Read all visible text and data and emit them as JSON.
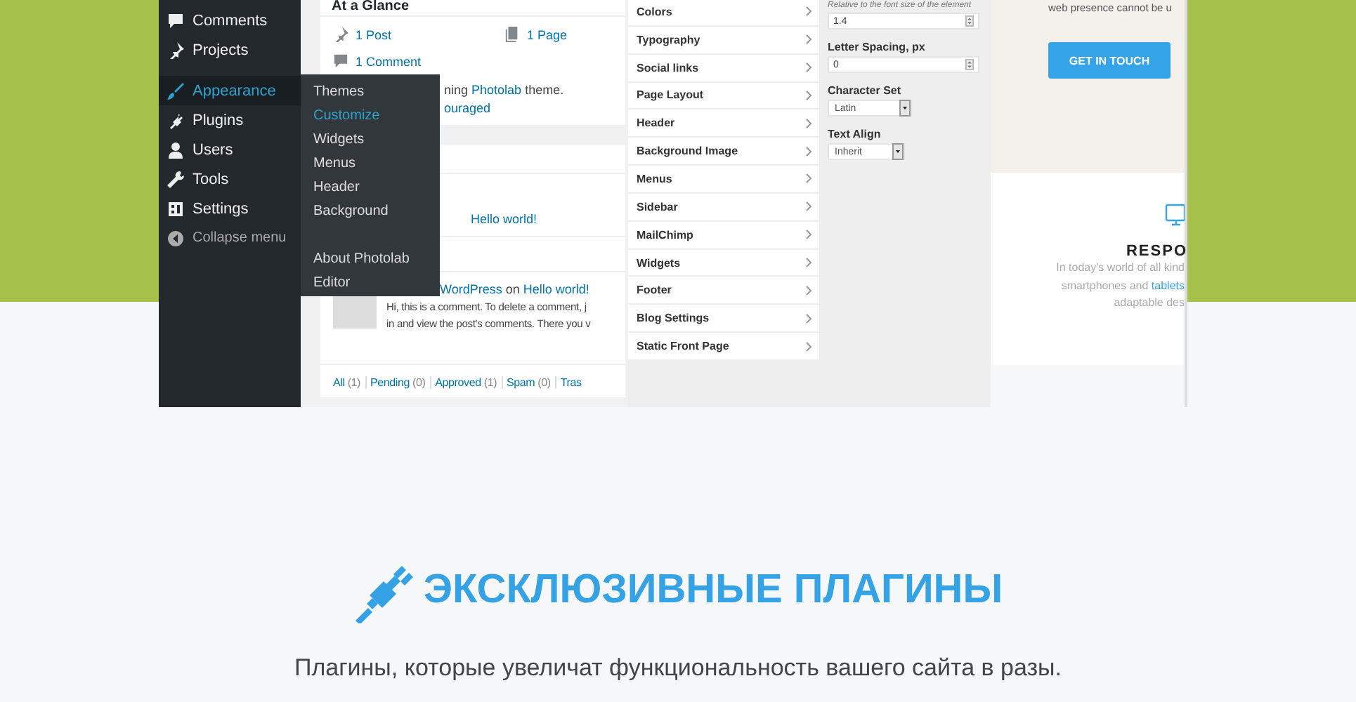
{
  "admin_menu": {
    "groups": [
      [
        {
          "label": "Comments",
          "selected": false
        },
        {
          "label": "Projects",
          "selected": false
        }
      ],
      [
        {
          "label": "Appearance",
          "selected": true
        },
        {
          "label": "Plugins",
          "selected": false
        },
        {
          "label": "Users",
          "selected": false
        },
        {
          "label": "Tools",
          "selected": false
        },
        {
          "label": "Settings",
          "selected": false
        }
      ]
    ],
    "collapse": "Collapse menu"
  },
  "submenu": {
    "groups": [
      [
        {
          "label": "Themes",
          "selected": false
        },
        {
          "label": "Customize",
          "selected": true
        },
        {
          "label": "Widgets",
          "selected": false
        },
        {
          "label": "Menus",
          "selected": false
        },
        {
          "label": "Header",
          "selected": false
        },
        {
          "label": "Background",
          "selected": false
        }
      ],
      [
        {
          "label": "About Photolab",
          "selected": false
        },
        {
          "label": "Editor",
          "selected": false
        }
      ]
    ]
  },
  "dashboard": {
    "glance_title": "At a Glance",
    "glance_items": [
      "1 Post",
      "1 Page",
      "1 Comment"
    ],
    "theme_line": {
      "before": "ning ",
      "link": "Photolab",
      "after": " theme."
    },
    "theme_line_2": "ouraged",
    "activity_post": "Hello world!",
    "comment": {
      "author": "WordPress",
      "on": " on ",
      "post": "Hello world!",
      "lines": [
        "Hi, this is a comment. To delete a comment, j",
        "in and view the post's comments. There you v"
      ]
    },
    "filters": [
      {
        "label": "All",
        "count": " (1)"
      },
      {
        "label": "Pending",
        "count": " (0)"
      },
      {
        "label": "Approved",
        "count": " (1)"
      },
      {
        "label": "Spam",
        "count": " (0)"
      },
      {
        "label": "Tras"
      }
    ]
  },
  "customizer": {
    "sections": [
      "Colors",
      "Typography",
      "Social links",
      "Page Layout",
      "Header",
      "Background Image",
      "Menus",
      "Sidebar",
      "MailChimp",
      "Widgets",
      "Footer",
      "Blog Settings",
      "Static Front Page"
    ],
    "hint": "Relative to the font size of the element",
    "fields": [
      {
        "kind": "number",
        "value": "1.4"
      },
      {
        "kind": "number",
        "label": "Letter Spacing, px",
        "value": "0"
      },
      {
        "kind": "select",
        "label": "Character Set",
        "value": "Latin"
      },
      {
        "kind": "select",
        "label": "Text Align",
        "value": "Inherit"
      }
    ]
  },
  "preview": {
    "intro": "web presence cannot be u",
    "button": "GET IN TOUCH",
    "feature_title": "RESPO",
    "feature_lines": [
      {
        "text": "In today's world of all kind"
      },
      {
        "text": "smartphones and ",
        "link": "tablets"
      },
      {
        "text": "adaptable des"
      }
    ]
  },
  "section": {
    "title": "ЭКСКЛЮЗИВНЫЕ ПЛАГИНЫ",
    "subtitle": "Плагины, которые увеличат функциональность вашего сайта в разы."
  }
}
